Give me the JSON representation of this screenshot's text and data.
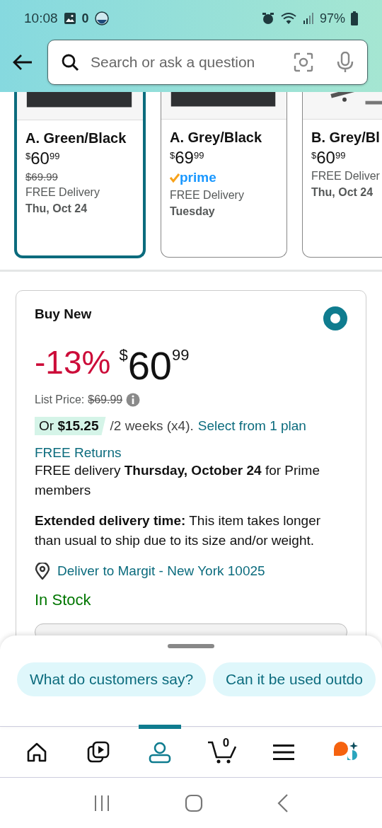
{
  "status_bar": {
    "time": "10:08",
    "notification_count": "0",
    "battery": "97%"
  },
  "header": {
    "search": {
      "placeholder": "Search or ask a question"
    }
  },
  "variants": [
    {
      "name": "A. Green/Black",
      "price": {
        "symbol": "$",
        "whole": "60",
        "fraction": "99"
      },
      "list_price": "$69.99",
      "delivery": "FREE Delivery",
      "date": "Thu, Oct 24",
      "selected": true
    },
    {
      "name": "A. Grey/Black",
      "price": {
        "symbol": "$",
        "whole": "69",
        "fraction": "99"
      },
      "badge": "prime",
      "delivery": "FREE Delivery",
      "date": "Tuesday",
      "selected": false
    },
    {
      "name": "B. Grey/Bl",
      "price": {
        "symbol": "$",
        "whole": "60",
        "fraction": "99"
      },
      "delivery": "FREE Deliver",
      "date": "Thu, Oct 24",
      "selected": false
    }
  ],
  "buy_box": {
    "title": "Buy New",
    "selected": true,
    "discount": "-13%",
    "price": {
      "symbol": "$",
      "whole": "60",
      "fraction": "99"
    },
    "list_price_label": "List Price:",
    "list_price": "$69.99",
    "installment": {
      "amount": "Or **$15.25**",
      "terms": "/2 weeks (x4).",
      "link": "Select from 1 plan"
    },
    "returns": "FREE Returns",
    "delivery": "FREE delivery **Thursday, October 24** for Prime members",
    "extended_note": "**Extended delivery time:** This item takes longer than usual to ship due to its size and/or weight.",
    "location": "Deliver to Margit - New York 10025",
    "stock": "In Stock"
  },
  "suggestions": [
    "What do customers say?",
    "Can it be used outdo"
  ],
  "bottom_nav": [
    {
      "kind": "home",
      "selected": false
    },
    {
      "kind": "video",
      "selected": false
    },
    {
      "kind": "account",
      "selected": true
    },
    {
      "kind": "cart",
      "count": "0",
      "selected": false
    },
    {
      "kind": "menu",
      "selected": false
    },
    {
      "kind": "assistant",
      "selected": false
    }
  ]
}
